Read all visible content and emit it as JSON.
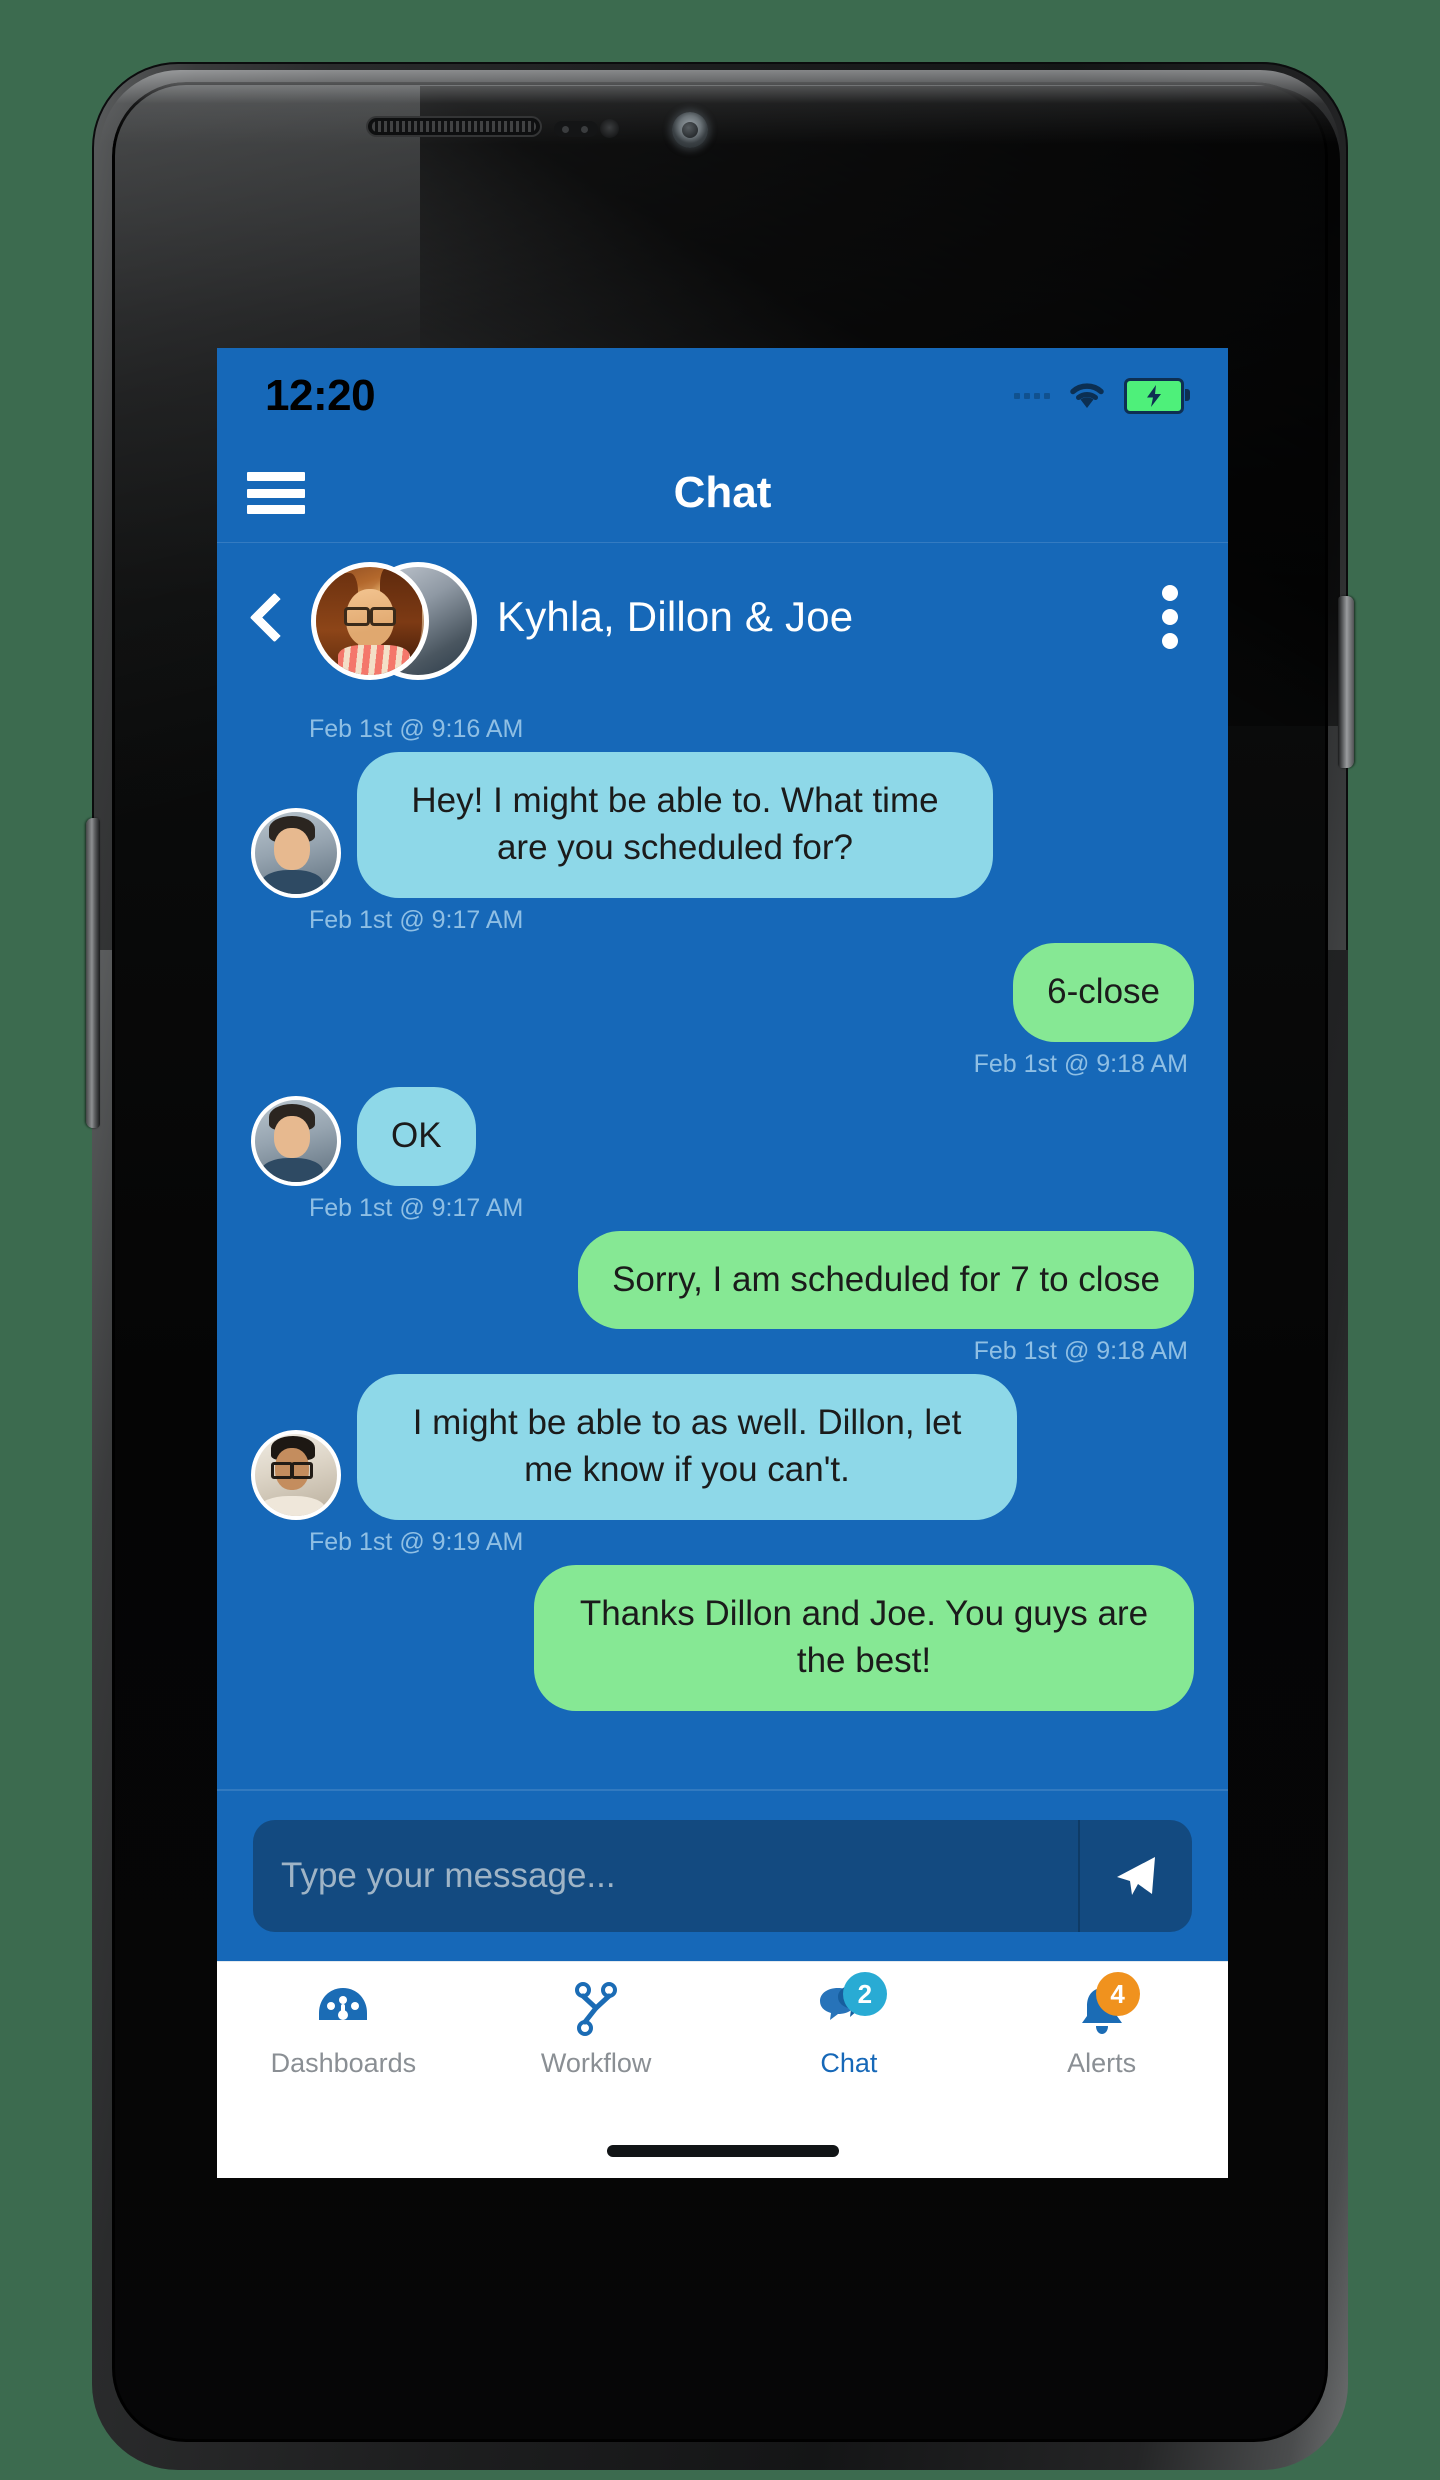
{
  "status_bar": {
    "time": "12:20",
    "wifi_icon": "wifi-icon",
    "battery_icon": "battery-charging-icon",
    "signal_icon": "signal-dots-icon"
  },
  "app_bar": {
    "menu_icon": "hamburger-menu-icon",
    "title": "Chat"
  },
  "conversation_header": {
    "back_icon": "back-chevron-icon",
    "avatar": "group-avatar",
    "title": "Kyhla, Dillon & Joe",
    "overflow_icon": "kebab-menu-icon"
  },
  "messages": [
    {
      "id": "m1",
      "direction": "in",
      "timestamp": "Feb 1st @ 9:16 AM",
      "text": "Hey! I might be able to. What time are you scheduled for?",
      "avatar": "dillon"
    },
    {
      "id": "m2",
      "direction": "out",
      "timestamp": "Feb 1st @ 9:17 AM",
      "text": "6-close",
      "avatar": null
    },
    {
      "id": "m3",
      "direction": "in",
      "timestamp": "Feb 1st @ 9:18 AM",
      "text": "OK",
      "avatar": "dillon"
    },
    {
      "id": "m4",
      "direction": "out",
      "timestamp": "Feb 1st @ 9:17 AM",
      "text": "Sorry, I am scheduled for 7 to close",
      "avatar": null
    },
    {
      "id": "m5",
      "direction": "in",
      "timestamp": "Feb 1st @ 9:18 AM",
      "text": "I might be able to as well. Dillon, let me know if you can't.",
      "avatar": "joe"
    },
    {
      "id": "m6",
      "direction": "out",
      "timestamp": "Feb 1st @ 9:19 AM",
      "text": "Thanks Dillon and Joe. You guys are the best!",
      "avatar": null
    }
  ],
  "composer": {
    "placeholder": "Type your message...",
    "value": "",
    "send_icon": "send-paper-plane-icon"
  },
  "bottom_nav": {
    "items": [
      {
        "label": "Dashboards",
        "icon": "gauge-icon",
        "badge": null,
        "active": false
      },
      {
        "label": "Workflow",
        "icon": "workflow-branch-icon",
        "badge": null,
        "active": false
      },
      {
        "label": "Chat",
        "icon": "chat-bubbles-icon",
        "badge": "2",
        "active": true
      },
      {
        "label": "Alerts",
        "icon": "bell-icon",
        "badge": "4",
        "active": false
      }
    ]
  },
  "colors": {
    "header_blue": "#1668b8",
    "incoming_bubble": "#8ed8e8",
    "outgoing_bubble": "#86e894",
    "timestamp": "#8fbfe4",
    "input_bg": "#134a80",
    "nav_icon_blue": "#1b6cb5",
    "chat_badge": "#29abd4",
    "alerts_badge": "#f0921e",
    "battery_green": "#4ef07a"
  }
}
